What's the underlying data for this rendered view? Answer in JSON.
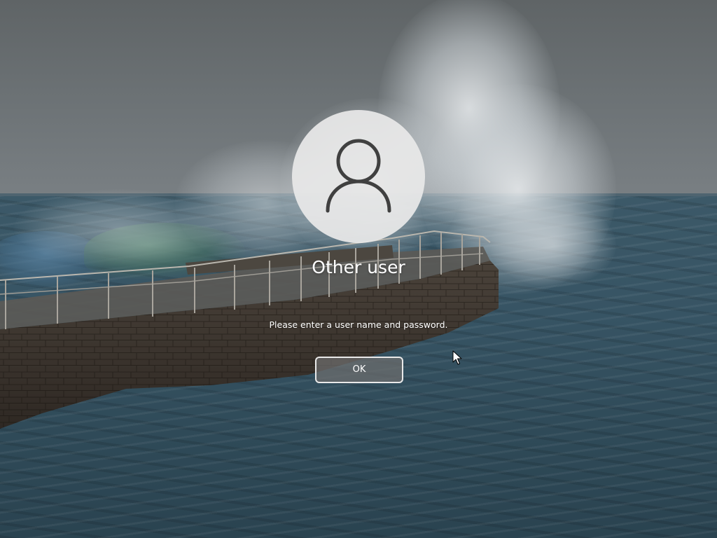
{
  "login": {
    "username": "Other user",
    "message": "Please enter a user name and password.",
    "ok_label": "OK"
  },
  "icons": {
    "avatar": "user-silhouette-icon",
    "cursor": "mouse-pointer-icon"
  },
  "colors": {
    "avatar_bg": "#e8e8e8",
    "avatar_glyph": "#404040",
    "text": "#ffffff",
    "button_border": "#e9e9e9",
    "button_fill": "#6e6e6e"
  }
}
